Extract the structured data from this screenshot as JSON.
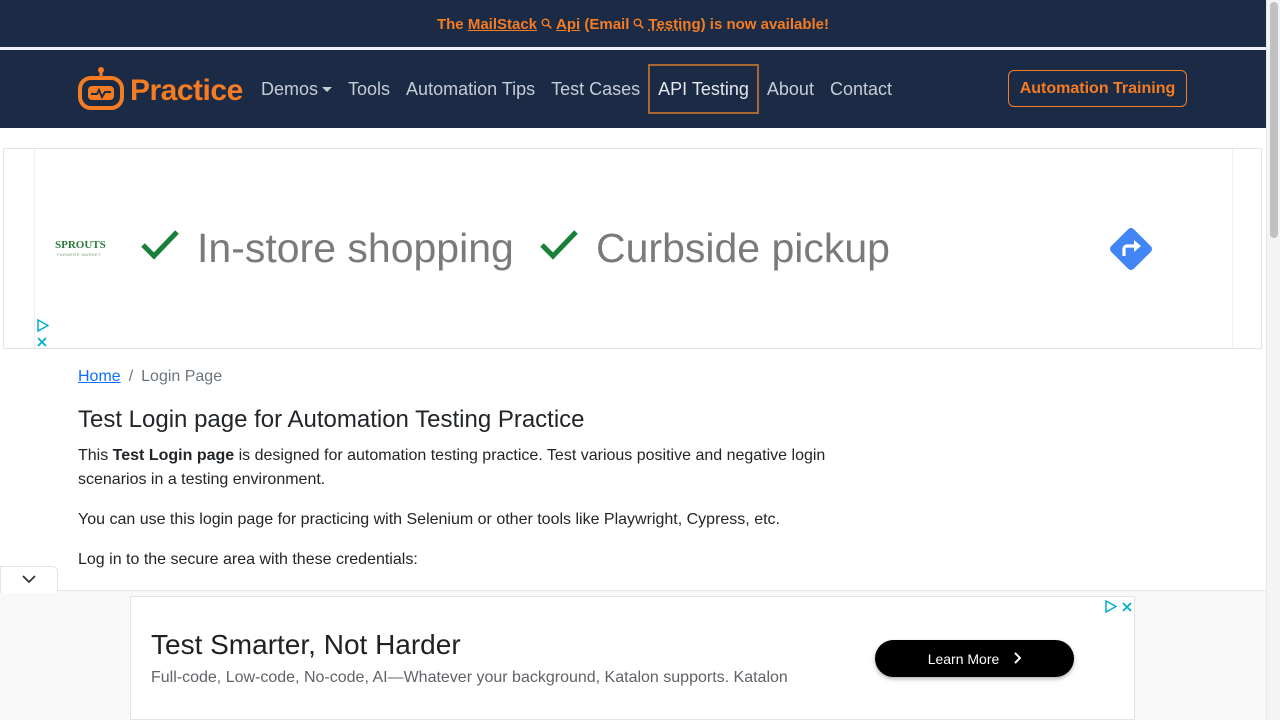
{
  "announcement": {
    "prefix": "The",
    "link1": "MailStack",
    "link2": "Api",
    "mid": "(Email",
    "link3": "Testing",
    "suffix": ") is now available!"
  },
  "brand": {
    "name": "Practice"
  },
  "nav": {
    "items": [
      {
        "label": "Demos"
      },
      {
        "label": "Tools"
      },
      {
        "label": "Automation Tips"
      },
      {
        "label": "Test Cases"
      },
      {
        "label": "API Testing"
      },
      {
        "label": "About"
      },
      {
        "label": "Contact"
      }
    ],
    "active": "API Testing",
    "cta": "Automation Training"
  },
  "ad_top": {
    "advertiser": "SPROUTS",
    "advertiser_sub": "FARMERS MARKET",
    "feature1": "In-store shopping",
    "feature2": "Curbside pickup"
  },
  "breadcrumb": {
    "home": "Home",
    "separator": "/",
    "current": "Login Page"
  },
  "main": {
    "title": "Test Login page for Automation Testing Practice",
    "intro_pre": "This ",
    "intro_bold": "Test Login page",
    "intro_post": " is designed for automation testing practice. Test various positive and negative login scenarios in a testing environment.",
    "tools_text": "You can use this login page for practicing with Selenium or other tools like Playwright, Cypress, etc.",
    "creds_text": "Log in to the secure area with these credentials:"
  },
  "ad_bottom": {
    "title": "Test Smarter, Not Harder",
    "subtitle": "Full-code, Low-code, No-code, AI—Whatever your background, Katalon supports. Katalon",
    "button": "Learn More"
  },
  "colors": {
    "nav_bg": "#1b2b45",
    "accent": "#f57c22",
    "link": "#0d6efd",
    "check": "#188038",
    "direction": "#4285f4"
  }
}
